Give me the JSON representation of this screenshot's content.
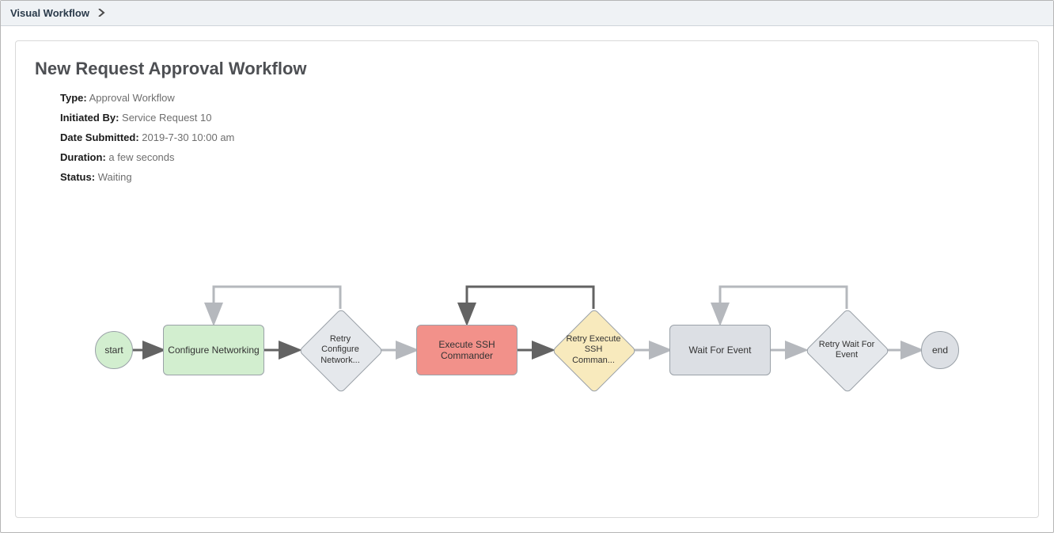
{
  "breadcrumb": {
    "title": "Visual Workflow"
  },
  "page": {
    "title": "New Request Approval Workflow"
  },
  "meta": {
    "type_label": "Type:",
    "type_value": "Approval Workflow",
    "initiated_label": "Initiated By:",
    "initiated_value": "Service Request 10",
    "date_label": "Date Submitted:",
    "date_value": "2019-7-30 10:00 am",
    "duration_label": "Duration:",
    "duration_value": "a few seconds",
    "status_label": "Status:",
    "status_value": "Waiting"
  },
  "diagram": {
    "nodes": {
      "start": {
        "label": "start",
        "type": "circle",
        "color": "green"
      },
      "cfg": {
        "label": "Configure Networking",
        "type": "rect",
        "color": "green"
      },
      "retry1": {
        "label": "Retry Configure Network...",
        "type": "diamond",
        "color": "lightgrey"
      },
      "exec": {
        "label": "Execute SSH Commander",
        "type": "rect",
        "color": "red"
      },
      "retry2": {
        "label": "Retry Execute SSH Comman...",
        "type": "diamond",
        "color": "yellow"
      },
      "wait": {
        "label": "Wait For Event",
        "type": "rect",
        "color": "grey"
      },
      "retry3": {
        "label": "Retry Wait For Event",
        "type": "diamond",
        "color": "lightgrey"
      },
      "end": {
        "label": "end",
        "type": "circle",
        "color": "grey"
      }
    },
    "edges": [
      {
        "from": "start",
        "to": "cfg",
        "style": "dark"
      },
      {
        "from": "cfg",
        "to": "retry1",
        "style": "dark"
      },
      {
        "from": "retry1",
        "to": "exec",
        "style": "light"
      },
      {
        "from": "retry1",
        "to": "cfg",
        "style": "light",
        "loopback": true
      },
      {
        "from": "exec",
        "to": "retry2",
        "style": "dark"
      },
      {
        "from": "retry2",
        "to": "wait",
        "style": "light"
      },
      {
        "from": "retry2",
        "to": "exec",
        "style": "dark",
        "loopback": true
      },
      {
        "from": "wait",
        "to": "retry3",
        "style": "light"
      },
      {
        "from": "retry3",
        "to": "end",
        "style": "light"
      },
      {
        "from": "retry3",
        "to": "wait",
        "style": "light",
        "loopback": true
      }
    ]
  }
}
